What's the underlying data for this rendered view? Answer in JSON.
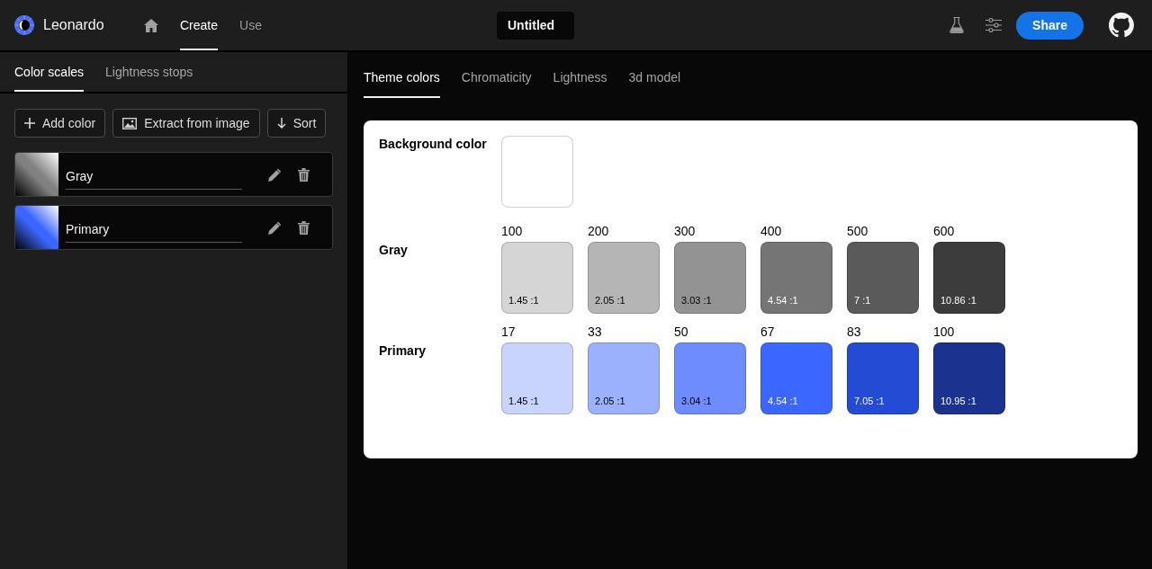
{
  "header": {
    "app_name": "Leonardo",
    "nav": [
      {
        "label": "Create",
        "selected": true
      },
      {
        "label": "Use",
        "selected": false
      }
    ],
    "title_field": {
      "value": "Untitled"
    },
    "share_button": {
      "label": "Share"
    }
  },
  "sidebar": {
    "tabs": [
      {
        "label": "Color scales",
        "selected": true
      },
      {
        "label": "Lightness stops",
        "selected": false
      }
    ],
    "buttons": [
      {
        "kind": "add",
        "label": "Add color"
      },
      {
        "kind": "image",
        "label": "Extract from image"
      },
      {
        "kind": "sort",
        "label": "Sort"
      }
    ],
    "scales": [
      {
        "name": "Gray",
        "color": "#808080"
      },
      {
        "name": "Primary",
        "color": "#3b66ff"
      }
    ]
  },
  "main": {
    "tabs": [
      {
        "label": "Theme colors",
        "selected": true
      },
      {
        "label": "Chromaticity",
        "selected": false
      },
      {
        "label": "Lightness",
        "selected": false
      },
      {
        "label": "3d model",
        "selected": false
      }
    ],
    "theme": {
      "background": {
        "label": "Background color",
        "color": "#ffffff"
      },
      "scales": [
        {
          "name": "Gray",
          "swatches": [
            {
              "step": "100",
              "ratio": "1.45 :1",
              "color": "#d5d5d5"
            },
            {
              "step": "200",
              "ratio": "2.05 :1",
              "color": "#b5b5b5"
            },
            {
              "step": "300",
              "ratio": "3.03 :1",
              "color": "#939393"
            },
            {
              "step": "400",
              "ratio": "4.54 :1",
              "color": "#757575"
            },
            {
              "step": "500",
              "ratio": "7 :1",
              "color": "#5a5a5a"
            },
            {
              "step": "600",
              "ratio": "10.86 :1",
              "color": "#3c3c3c"
            }
          ]
        },
        {
          "name": "Primary",
          "swatches": [
            {
              "step": "17",
              "ratio": "1.45 :1",
              "color": "#c8d4fe"
            },
            {
              "step": "33",
              "ratio": "2.05 :1",
              "color": "#9cb1fd"
            },
            {
              "step": "50",
              "ratio": "3.04 :1",
              "color": "#6e8cfe"
            },
            {
              "step": "67",
              "ratio": "4.54 :1",
              "color": "#3b66ff"
            },
            {
              "step": "83",
              "ratio": "7.05 :1",
              "color": "#234bd4"
            },
            {
              "step": "100",
              "ratio": "10.95 :1",
              "color": "#1b338f"
            }
          ]
        }
      ]
    }
  }
}
